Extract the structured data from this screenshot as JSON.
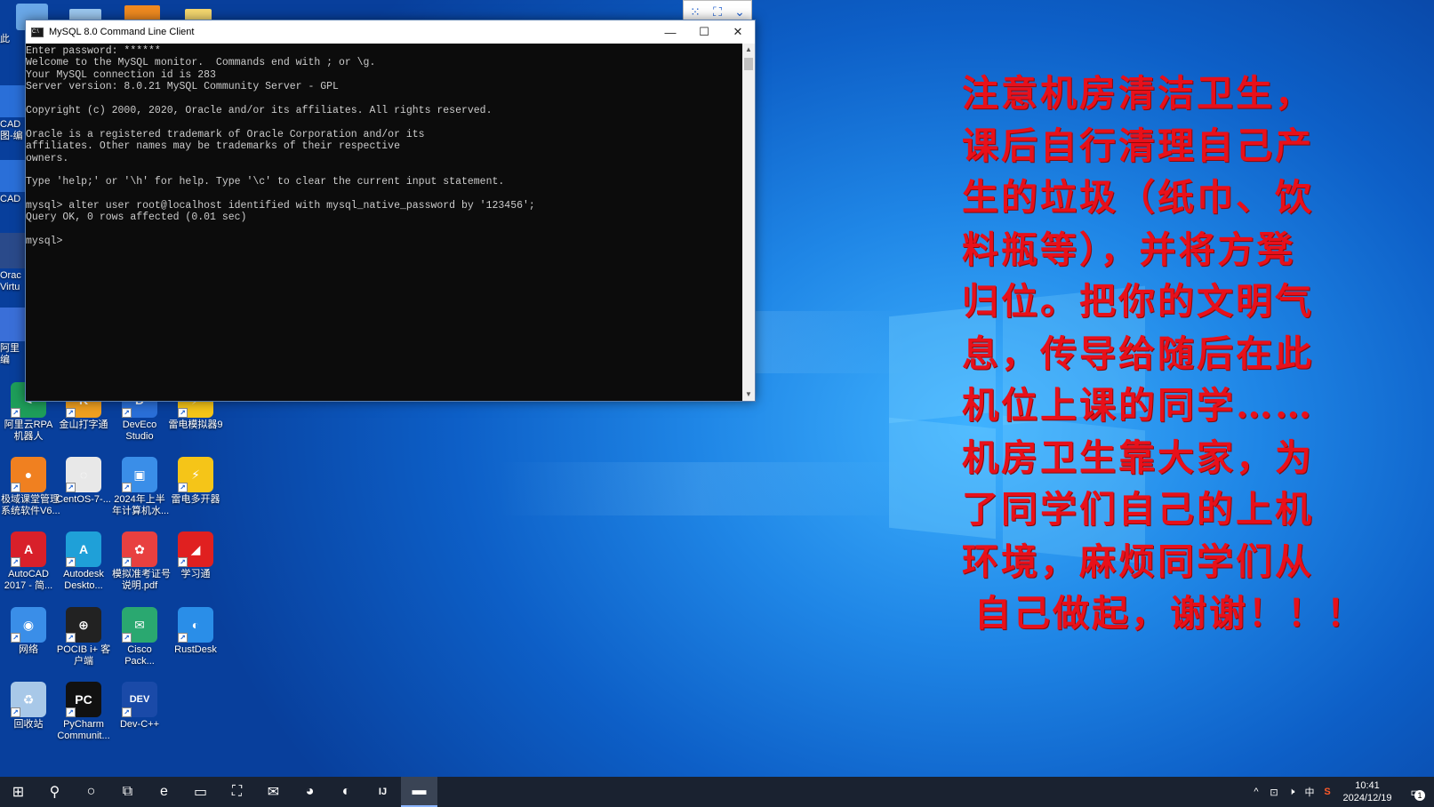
{
  "window": {
    "title": "MySQL 8.0 Command Line Client",
    "minimize_glyph": "—",
    "maximize_glyph": "☐",
    "close_glyph": "✕",
    "lines": [
      "Enter password: ******",
      "Welcome to the MySQL monitor.  Commands end with ; or \\g.",
      "Your MySQL connection id is 283",
      "Server version: 8.0.21 MySQL Community Server - GPL",
      "",
      "Copyright (c) 2000, 2020, Oracle and/or its affiliates. All rights reserved.",
      "",
      "Oracle is a registered trademark of Oracle Corporation and/or its",
      "affiliates. Other names may be trademarks of their respective",
      "owners.",
      "",
      "Type 'help;' or '\\h' for help. Type '\\c' to clear the current input statement.",
      "",
      "mysql> alter user root@localhost identified with mysql_native_password by '123456';",
      "Query OK, 0 rows affected (0.01 sec)",
      "",
      "mysql>"
    ]
  },
  "desktop_icons": [
    {
      "label": "阿里云RPA\n机器人",
      "color": "#1e9e5a",
      "glyph": "<"
    },
    {
      "label": "金山打字通",
      "color": "#f0a020",
      "glyph": "K"
    },
    {
      "label": "DevEco\nStudio",
      "color": "#2a6fd8",
      "glyph": "D"
    },
    {
      "label": "雷电模拟器9",
      "color": "#f5c518",
      "glyph": "⚡"
    },
    {
      "label": "极域课堂管理\n系统软件V6...",
      "color": "#f08020",
      "glyph": "●"
    },
    {
      "label": "CentOS-7-...",
      "color": "#e8e8e8",
      "glyph": "◌"
    },
    {
      "label": "2024年上半\n年计算机水...",
      "color": "#3a8ee8",
      "glyph": "▣"
    },
    {
      "label": "雷电多开器",
      "color": "#f5c518",
      "glyph": "⚡"
    },
    {
      "label": "AutoCAD\n2017 - 简...",
      "color": "#d8202a",
      "glyph": "A"
    },
    {
      "label": "Autodesk\nDeskto...",
      "color": "#1fa0d8",
      "glyph": "A"
    },
    {
      "label": "模拟准考证号\n说明.pdf",
      "color": "#e84040",
      "glyph": "✿"
    },
    {
      "label": "学习通",
      "color": "#e02020",
      "glyph": "◢"
    },
    {
      "label": "网络",
      "color": "#3a8ee8",
      "glyph": "◉"
    },
    {
      "label": "POCIB i+ 客\n户端",
      "color": "#222222",
      "glyph": "⊕"
    },
    {
      "label": "Cisco\nPack...",
      "color": "#2aa870",
      "glyph": "✉"
    },
    {
      "label": "RustDesk",
      "color": "#2a8ee8",
      "glyph": "◐"
    },
    {
      "label": "回收站",
      "color": "#a8c8e8",
      "glyph": "♻"
    },
    {
      "label": "PyCharm\nCommunit...",
      "color": "#111111",
      "glyph": "PC"
    },
    {
      "label": "Dev-C++",
      "color": "#1a4aa8",
      "glyph": "DEV"
    }
  ],
  "partial_icons": [
    {
      "label": "此",
      "color": "#6aa8e8"
    },
    {
      "label": "CAD\n图-编",
      "color": "#2a6fd8"
    },
    {
      "label": "CAD",
      "color": "#2a6fd8"
    },
    {
      "label": "Orac\nVirtu",
      "color": "#2a4a8a"
    },
    {
      "label": "阿里\n编",
      "color": "#3a6fd8"
    }
  ],
  "notice": {
    "lines": [
      "注意机房清洁卫生，",
      "课后自行清理自己产",
      "生的垃圾（纸巾、饮",
      "料瓶等），并将方凳",
      "归位。把你的文明气",
      "息，传导给随后在此",
      "机位上课的同学……",
      "机房卫生靠大家，为",
      "了同学们自己的上机",
      "环境，麻烦同学们从",
      "自己做起，谢谢！！！"
    ]
  },
  "taskbar": {
    "items": [
      {
        "name": "start-button",
        "glyph": "⊞"
      },
      {
        "name": "search-icon",
        "glyph": "⚲"
      },
      {
        "name": "cortana-icon",
        "glyph": "○"
      },
      {
        "name": "task-view-icon",
        "glyph": "⧉"
      },
      {
        "name": "edge-icon",
        "glyph": "e"
      },
      {
        "name": "file-explorer-icon",
        "glyph": "▭"
      },
      {
        "name": "store-icon",
        "glyph": "⛶"
      },
      {
        "name": "mail-icon",
        "glyph": "✉"
      },
      {
        "name": "chrome-icon",
        "glyph": "◕"
      },
      {
        "name": "rustdesk-icon",
        "glyph": "◐"
      },
      {
        "name": "intellij-icon",
        "glyph": "IJ"
      },
      {
        "name": "mysql-console-icon",
        "glyph": "▬"
      }
    ],
    "tray": {
      "chevron": "^",
      "network": "⊡",
      "volume": "🕨",
      "ime": "中",
      "sogou": "S",
      "time": "10:41",
      "date": "2024/12/19",
      "notifications": "1"
    }
  }
}
